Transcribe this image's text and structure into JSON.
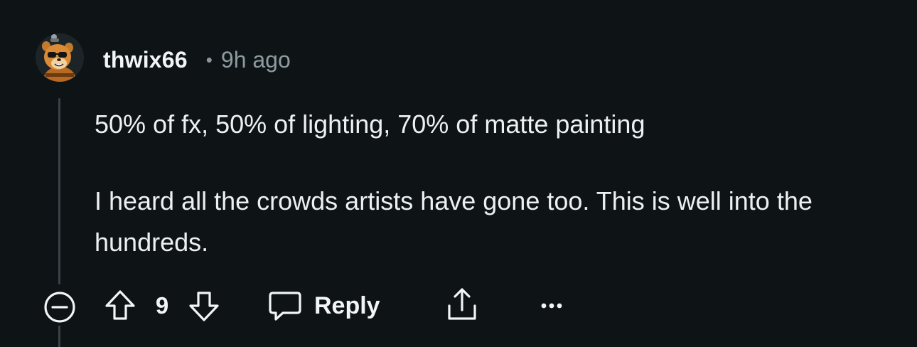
{
  "comment": {
    "author": "thwix66",
    "separator": "•",
    "time": "9h ago",
    "paragraphs": [
      "50% of fx, 50% of lighting, 70% of matte painting",
      "I heard all the crowds artists have gone too. This is well into the hundreds."
    ],
    "votes": "9",
    "reply_label": "Reply"
  },
  "icons": {
    "collapse": "minus-circle-icon",
    "upvote": "arrow-up-icon",
    "downvote": "arrow-down-icon",
    "reply": "speech-bubble-icon",
    "share": "share-icon",
    "more": "more-icon"
  },
  "colors": {
    "background": "#0e1416",
    "text": "#edf0f2",
    "muted": "#8d9a9f",
    "thread_line": "#3a4246"
  }
}
